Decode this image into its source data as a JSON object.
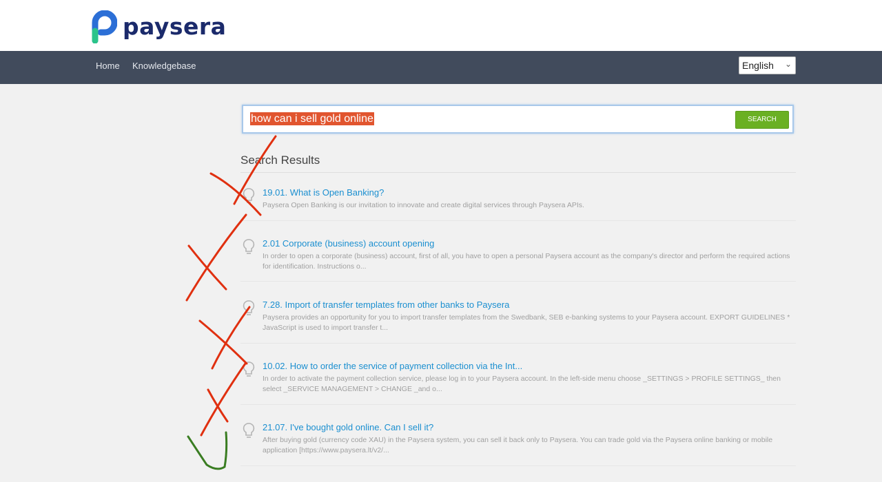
{
  "brand": {
    "name": "paysera",
    "color": "#1b2a6b"
  },
  "nav": {
    "home": "Home",
    "knowledgebase": "Knowledgebase"
  },
  "language": {
    "selected": "English"
  },
  "search": {
    "query": "how can i sell gold online",
    "button_label": "SEARCH"
  },
  "results_title": "Search Results",
  "results": [
    {
      "title": "19.01. What is Open Banking?",
      "desc": "Paysera Open Banking is our invitation to innovate and create digital services through Paysera APIs.",
      "mark": "red-x"
    },
    {
      "title": "2.01 Corporate (business) account opening",
      "desc": "In order to open a corporate (business) account, first of all, you have to open a personal Paysera account as the company's director and perform the required actions for identification. Instructions o...",
      "mark": "red-x"
    },
    {
      "title": "7.28. Import of transfer templates from other banks to Paysera",
      "desc": "Paysera provides an opportunity for you to import transfer templates from the Swedbank, SEB e-banking systems to your Paysera account. EXPORT GUIDELINES * JavaScript is used to import transfer t...",
      "mark": "red-x"
    },
    {
      "title": "10.02. How to order the service of payment collection via the Int...",
      "desc": "In order to activate the payment collection service, please log in to your Paysera account. In the left-side menu choose _SETTINGS > PROFILE SETTINGS_ then select _SERVICE MANAGEMENT > CHANGE _and o...",
      "mark": "red-x"
    },
    {
      "title": "21.07. I've bought gold online. Can I sell it?",
      "desc": "After buying gold (currency code XAU) in the Paysera system, you can sell it back only to Paysera. You can trade gold via the Paysera online banking or mobile application [https://www.paysera.lt/v2/...",
      "mark": "green-check"
    }
  ],
  "colors": {
    "nav_bg": "#414b5c",
    "accent_green": "#6ab023",
    "link_blue": "#1b8fd0",
    "annotation_red": "#e03010",
    "annotation_green": "#3a7d22"
  }
}
